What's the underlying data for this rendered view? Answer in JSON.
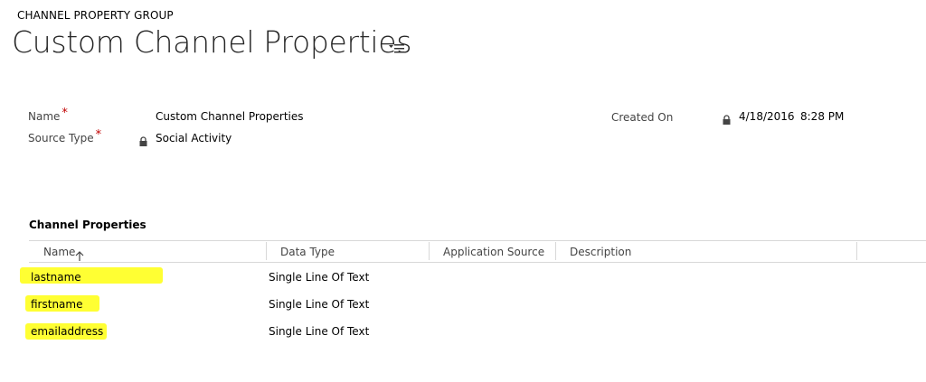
{
  "header": {
    "entity_label": "CHANNEL PROPERTY GROUP",
    "title": "Custom Channel Properties",
    "menu_icon": "list-menu-icon"
  },
  "form": {
    "name_label": "Name",
    "name_required": "*",
    "name_value": "Custom Channel Properties",
    "source_type_label": "Source Type",
    "source_type_required": "*",
    "source_type_value": "Social Activity",
    "created_on_label": "Created On",
    "created_on_date": "4/18/2016",
    "created_on_time": "8:28 PM"
  },
  "section": {
    "title": "Channel Properties"
  },
  "grid": {
    "columns": [
      "Name",
      "Data Type",
      "Application Source",
      "Description"
    ],
    "sort_column": "Name",
    "sort_direction": "ascending",
    "rows": [
      {
        "name": "lastname",
        "data_type": "Single Line Of Text",
        "application_source": "",
        "description": ""
      },
      {
        "name": "firstname",
        "data_type": "Single Line Of Text",
        "application_source": "",
        "description": ""
      },
      {
        "name": "emailaddress",
        "data_type": "Single Line Of Text",
        "application_source": "",
        "description": ""
      }
    ]
  },
  "colors": {
    "highlight": "#ffff33",
    "required": "#c00000",
    "divider": "#d8d8d8"
  }
}
